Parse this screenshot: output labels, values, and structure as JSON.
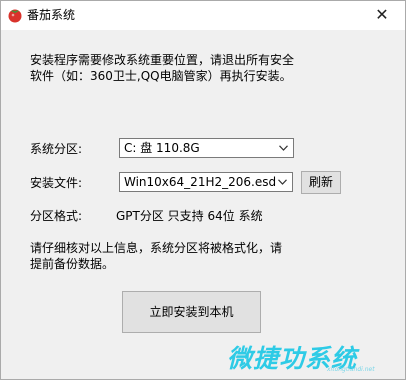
{
  "window": {
    "title": "番茄系统",
    "close_glyph": "✕"
  },
  "notice": {
    "line1": "安装程序需要修改系统重要位置，请退出所有安全",
    "line2": "软件（如：360卫士,QQ电脑管家）再执行安装。"
  },
  "form": {
    "partition_label": "系统分区:",
    "partition_value": "C:  盘  110.8G",
    "file_label": "安装文件:",
    "file_value": "Win10x64_21H2_206.esd",
    "refresh_label": "刷新",
    "format_label": "分区格式:",
    "format_value": "GPT分区 只支持 64位 系统"
  },
  "warning": {
    "line1": "请仔细核对以上信息，系统分区将被格式化，请",
    "line2": "提前备份数据。"
  },
  "actions": {
    "install_label": "立即安装到本机"
  },
  "watermark": {
    "text": "微捷功系统",
    "sub": "xitongtiandi.net"
  },
  "colors": {
    "watermark": "#2ecbe6",
    "tomato": "#d9322b"
  },
  "icons": {
    "app": "tomato-icon",
    "close": "close-icon",
    "dropdown": "chevron-down-icon"
  }
}
